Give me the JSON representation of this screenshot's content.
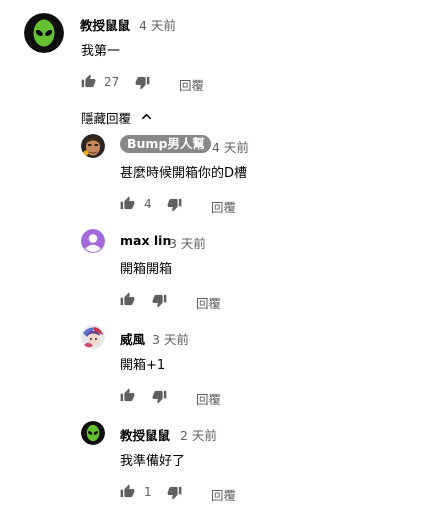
{
  "comments": [
    {
      "author": "教授鼠鼠",
      "time": "4 天前",
      "text": "我第一",
      "likes": "27",
      "reply_label": "回覆",
      "avatar_icon": "alien-avatar"
    }
  ],
  "hide_replies_label": "隱藏回覆",
  "replies": [
    {
      "author": "Bump男人幫",
      "time": "4 天前",
      "text": "甚麼時候開箱你的D槽",
      "likes": "4",
      "reply_label": "回覆",
      "avatar_icon": "face-avatar"
    },
    {
      "author": "max lin",
      "time": "3 天前",
      "text": "開箱開箱",
      "likes": "",
      "reply_label": "回覆",
      "avatar_icon": "default-user-avatar"
    },
    {
      "author": "威風",
      "time": "3 天前",
      "text": "開箱+1",
      "likes": "",
      "reply_label": "回覆",
      "avatar_icon": "anime-avatar"
    },
    {
      "author": "教授鼠鼠",
      "time": "2 天前",
      "text": "我準備好了",
      "likes": "1",
      "reply_label": "回覆",
      "avatar_icon": "alien-avatar"
    }
  ],
  "colors": {
    "alien_green": "#66c132",
    "default_avatar_purple": "#a26ad8",
    "badge_gray": "#888888",
    "icon_gray": "#606060"
  }
}
